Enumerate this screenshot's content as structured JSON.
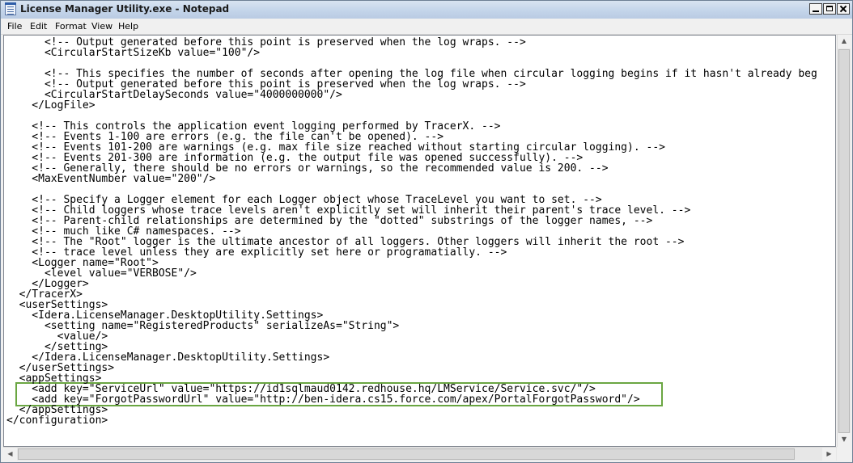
{
  "window": {
    "title": "License Manager Utility.exe - Notepad"
  },
  "menu": [
    "File",
    "Edit",
    "Format",
    "View",
    "Help"
  ],
  "icons": {
    "app": "notepad-icon",
    "minimize": "minimize-icon",
    "maximize": "maximize-icon",
    "close": "close-icon"
  },
  "highlight": {
    "color": "#6aa642"
  },
  "document": {
    "lines": [
      "      <!-- Output generated before this point is preserved when the log wraps. -->",
      "      <CircularStartSizeKb value=\"100\"/>",
      "",
      "      <!-- This specifies the number of seconds after opening the log file when circular logging begins if it hasn't already beg",
      "      <!-- Output generated before this point is preserved when the log wraps. -->",
      "      <CircularStartDelaySeconds value=\"4000000000\"/>",
      "    </LogFile>",
      "",
      "    <!-- This controls the application event logging performed by TracerX. -->",
      "    <!-- Events 1-100 are errors (e.g. the file can't be opened). -->",
      "    <!-- Events 101-200 are warnings (e.g. max file size reached without starting circular logging). -->",
      "    <!-- Events 201-300 are information (e.g. the output file was opened successfully). -->",
      "    <!-- Generally, there should be no errors or warnings, so the recommended value is 200. -->",
      "    <MaxEventNumber value=\"200\"/>",
      "",
      "    <!-- Specify a Logger element for each Logger object whose TraceLevel you want to set. -->",
      "    <!-- Child loggers whose trace levels aren't explicitly set will inherit their parent's trace level. -->",
      "    <!-- Parent-child relationships are determined by the \"dotted\" substrings of the logger names, -->",
      "    <!-- much like C# namespaces. -->",
      "    <!-- The \"Root\" logger is the ultimate ancestor of all loggers. Other loggers will inherit the root -->",
      "    <!-- trace level unless they are explicitly set here or programatially. -->",
      "    <Logger name=\"Root\">",
      "      <level value=\"VERBOSE\"/>",
      "    </Logger>",
      "  </TracerX>",
      "  <userSettings>",
      "    <Idera.LicenseManager.DesktopUtility.Settings>",
      "      <setting name=\"RegisteredProducts\" serializeAs=\"String\">",
      "        <value/>",
      "      </setting>",
      "    </Idera.LicenseManager.DesktopUtility.Settings>",
      "  </userSettings>",
      "  <appSettings>",
      "    <add key=\"ServiceUrl\" value=\"https://id1sqlmaud0142.redhouse.hq/LMService/Service.svc/\"/>",
      "    <add key=\"ForgotPasswordUrl\" value=\"http://ben-idera.cs15.force.com/apex/PortalForgotPassword\"/>",
      "  </appSettings>",
      "</configuration>"
    ]
  }
}
